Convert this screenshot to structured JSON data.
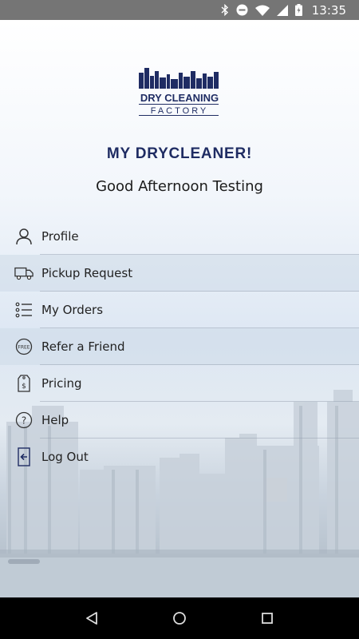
{
  "status_bar": {
    "time": "13:35",
    "icons": [
      "bluetooth-icon",
      "do-not-disturb-icon",
      "wifi-icon",
      "cellular-signal-icon",
      "battery-icon"
    ]
  },
  "app": {
    "logo_text_line1": "DRY CLEANING",
    "logo_text_line2": "FACTORY",
    "title": "MY DRYCLEANER!",
    "greeting": "Good Afternoon Testing"
  },
  "menu": {
    "items": [
      {
        "label": "Profile",
        "icon": "person-icon"
      },
      {
        "label": "Pickup Request",
        "icon": "truck-icon"
      },
      {
        "label": "My Orders",
        "icon": "list-icon"
      },
      {
        "label": "Refer a Friend",
        "icon": "free-badge-icon"
      },
      {
        "label": "Pricing",
        "icon": "price-tag-icon"
      },
      {
        "label": "Help",
        "icon": "help-icon"
      },
      {
        "label": "Log Out",
        "icon": "logout-icon"
      }
    ]
  },
  "nav_bar": {
    "icons": [
      "back-icon",
      "home-icon",
      "recents-icon"
    ]
  },
  "colors": {
    "status_bar": "#757575",
    "brand_navy": "#1f2c63",
    "nav_bar": "#000000"
  }
}
